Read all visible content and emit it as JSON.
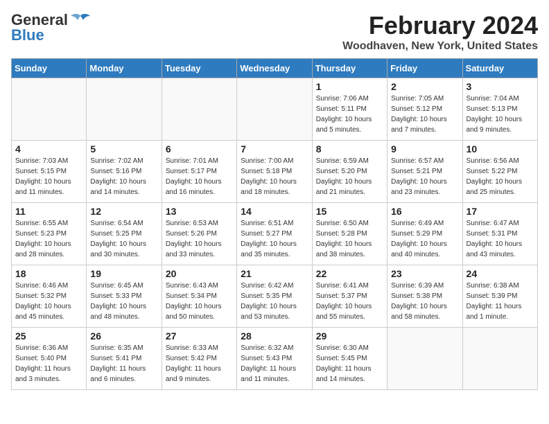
{
  "header": {
    "logo": {
      "line1": "General",
      "line2": "Blue"
    },
    "title": "February 2024",
    "subtitle": "Woodhaven, New York, United States"
  },
  "days_of_week": [
    "Sunday",
    "Monday",
    "Tuesday",
    "Wednesday",
    "Thursday",
    "Friday",
    "Saturday"
  ],
  "weeks": [
    [
      {
        "day": "",
        "info": ""
      },
      {
        "day": "",
        "info": ""
      },
      {
        "day": "",
        "info": ""
      },
      {
        "day": "",
        "info": ""
      },
      {
        "day": "1",
        "info": "Sunrise: 7:06 AM\nSunset: 5:11 PM\nDaylight: 10 hours\nand 5 minutes."
      },
      {
        "day": "2",
        "info": "Sunrise: 7:05 AM\nSunset: 5:12 PM\nDaylight: 10 hours\nand 7 minutes."
      },
      {
        "day": "3",
        "info": "Sunrise: 7:04 AM\nSunset: 5:13 PM\nDaylight: 10 hours\nand 9 minutes."
      }
    ],
    [
      {
        "day": "4",
        "info": "Sunrise: 7:03 AM\nSunset: 5:15 PM\nDaylight: 10 hours\nand 11 minutes."
      },
      {
        "day": "5",
        "info": "Sunrise: 7:02 AM\nSunset: 5:16 PM\nDaylight: 10 hours\nand 14 minutes."
      },
      {
        "day": "6",
        "info": "Sunrise: 7:01 AM\nSunset: 5:17 PM\nDaylight: 10 hours\nand 16 minutes."
      },
      {
        "day": "7",
        "info": "Sunrise: 7:00 AM\nSunset: 5:18 PM\nDaylight: 10 hours\nand 18 minutes."
      },
      {
        "day": "8",
        "info": "Sunrise: 6:59 AM\nSunset: 5:20 PM\nDaylight: 10 hours\nand 21 minutes."
      },
      {
        "day": "9",
        "info": "Sunrise: 6:57 AM\nSunset: 5:21 PM\nDaylight: 10 hours\nand 23 minutes."
      },
      {
        "day": "10",
        "info": "Sunrise: 6:56 AM\nSunset: 5:22 PM\nDaylight: 10 hours\nand 25 minutes."
      }
    ],
    [
      {
        "day": "11",
        "info": "Sunrise: 6:55 AM\nSunset: 5:23 PM\nDaylight: 10 hours\nand 28 minutes."
      },
      {
        "day": "12",
        "info": "Sunrise: 6:54 AM\nSunset: 5:25 PM\nDaylight: 10 hours\nand 30 minutes."
      },
      {
        "day": "13",
        "info": "Sunrise: 6:53 AM\nSunset: 5:26 PM\nDaylight: 10 hours\nand 33 minutes."
      },
      {
        "day": "14",
        "info": "Sunrise: 6:51 AM\nSunset: 5:27 PM\nDaylight: 10 hours\nand 35 minutes."
      },
      {
        "day": "15",
        "info": "Sunrise: 6:50 AM\nSunset: 5:28 PM\nDaylight: 10 hours\nand 38 minutes."
      },
      {
        "day": "16",
        "info": "Sunrise: 6:49 AM\nSunset: 5:29 PM\nDaylight: 10 hours\nand 40 minutes."
      },
      {
        "day": "17",
        "info": "Sunrise: 6:47 AM\nSunset: 5:31 PM\nDaylight: 10 hours\nand 43 minutes."
      }
    ],
    [
      {
        "day": "18",
        "info": "Sunrise: 6:46 AM\nSunset: 5:32 PM\nDaylight: 10 hours\nand 45 minutes."
      },
      {
        "day": "19",
        "info": "Sunrise: 6:45 AM\nSunset: 5:33 PM\nDaylight: 10 hours\nand 48 minutes."
      },
      {
        "day": "20",
        "info": "Sunrise: 6:43 AM\nSunset: 5:34 PM\nDaylight: 10 hours\nand 50 minutes."
      },
      {
        "day": "21",
        "info": "Sunrise: 6:42 AM\nSunset: 5:35 PM\nDaylight: 10 hours\nand 53 minutes."
      },
      {
        "day": "22",
        "info": "Sunrise: 6:41 AM\nSunset: 5:37 PM\nDaylight: 10 hours\nand 55 minutes."
      },
      {
        "day": "23",
        "info": "Sunrise: 6:39 AM\nSunset: 5:38 PM\nDaylight: 10 hours\nand 58 minutes."
      },
      {
        "day": "24",
        "info": "Sunrise: 6:38 AM\nSunset: 5:39 PM\nDaylight: 11 hours\nand 1 minute."
      }
    ],
    [
      {
        "day": "25",
        "info": "Sunrise: 6:36 AM\nSunset: 5:40 PM\nDaylight: 11 hours\nand 3 minutes."
      },
      {
        "day": "26",
        "info": "Sunrise: 6:35 AM\nSunset: 5:41 PM\nDaylight: 11 hours\nand 6 minutes."
      },
      {
        "day": "27",
        "info": "Sunrise: 6:33 AM\nSunset: 5:42 PM\nDaylight: 11 hours\nand 9 minutes."
      },
      {
        "day": "28",
        "info": "Sunrise: 6:32 AM\nSunset: 5:43 PM\nDaylight: 11 hours\nand 11 minutes."
      },
      {
        "day": "29",
        "info": "Sunrise: 6:30 AM\nSunset: 5:45 PM\nDaylight: 11 hours\nand 14 minutes."
      },
      {
        "day": "",
        "info": ""
      },
      {
        "day": "",
        "info": ""
      }
    ]
  ]
}
